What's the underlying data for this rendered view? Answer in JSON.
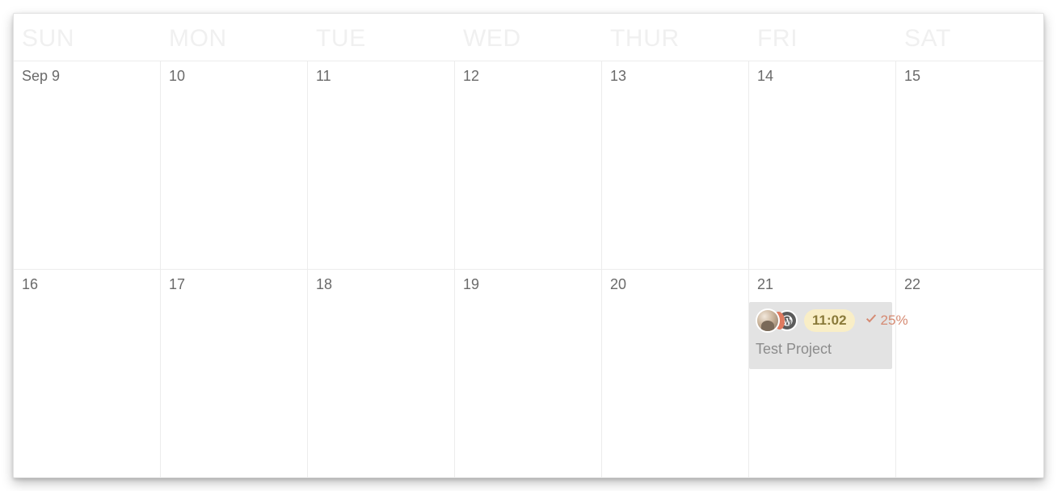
{
  "calendar": {
    "day_headers": [
      "SUN",
      "MON",
      "TUE",
      "WED",
      "THUR",
      "FRI",
      "SAT"
    ],
    "weeks": [
      {
        "days": [
          {
            "label": "Sep 9",
            "events": []
          },
          {
            "label": "10",
            "events": []
          },
          {
            "label": "11",
            "events": []
          },
          {
            "label": "12",
            "events": []
          },
          {
            "label": "13",
            "events": []
          },
          {
            "label": "14",
            "events": []
          },
          {
            "label": "15",
            "events": []
          }
        ]
      },
      {
        "days": [
          {
            "label": "16",
            "events": []
          },
          {
            "label": "17",
            "events": []
          },
          {
            "label": "18",
            "events": []
          },
          {
            "label": "19",
            "events": []
          },
          {
            "label": "20",
            "events": []
          },
          {
            "label": "21",
            "events": [
              {
                "time": "11:02",
                "progress_percent": "25%",
                "title": "Test Project",
                "service_icon": "wordpress-icon"
              }
            ]
          },
          {
            "label": "22",
            "events": []
          }
        ]
      }
    ]
  },
  "colors": {
    "header_text": "#f0f0f0",
    "day_number": "#6a6a6a",
    "event_bg": "#e3e3e3",
    "time_pill_bg": "#f9eec6",
    "time_pill_text": "#8a7a3a",
    "progress_accent": "#d58a72",
    "event_title": "#8c8c8c"
  }
}
